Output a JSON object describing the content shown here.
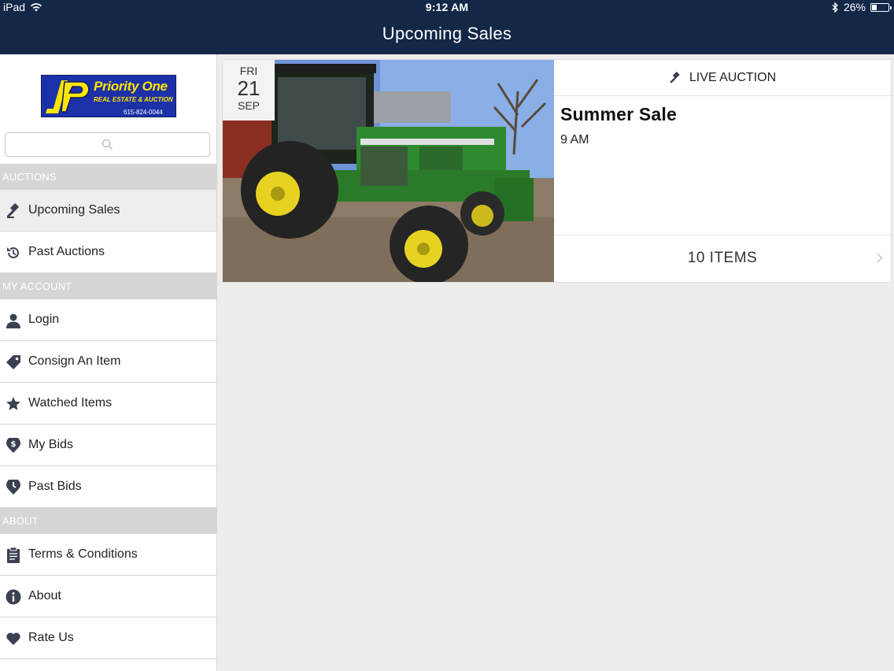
{
  "status": {
    "carrier": "iPad",
    "time": "9:12 AM",
    "battery": "26%",
    "battery_level": 0.26
  },
  "nav": {
    "title": "Upcoming Sales"
  },
  "logo": {
    "brand": "Priority One",
    "sub": "REAL ESTATE & AUCTION",
    "phone": "615-824-0044"
  },
  "sidebar": {
    "sections": [
      {
        "title": "AUCTIONS"
      },
      {
        "title": "MY ACCOUNT"
      },
      {
        "title": "ABOUT"
      }
    ],
    "items": [
      {
        "label": "Upcoming Sales",
        "icon": "gavel-icon"
      },
      {
        "label": "Past Auctions",
        "icon": "history-icon"
      },
      {
        "label": "Login",
        "icon": "user-icon"
      },
      {
        "label": "Consign An Item",
        "icon": "tag-icon"
      },
      {
        "label": "Watched Items",
        "icon": "star-icon"
      },
      {
        "label": "My Bids",
        "icon": "dollar-icon"
      },
      {
        "label": "Past Bids",
        "icon": "clock-badge-icon"
      },
      {
        "label": "Terms & Conditions",
        "icon": "clipboard-icon"
      },
      {
        "label": "About",
        "icon": "info-icon"
      },
      {
        "label": "Rate Us",
        "icon": "heart-icon"
      }
    ]
  },
  "sale": {
    "dow": "FRI",
    "day": "21",
    "month": "SEP",
    "type_label": "LIVE AUCTION",
    "title": "Summer Sale",
    "time": "9 AM",
    "items_label": "10 ITEMS"
  },
  "colors": {
    "nav_bg": "#132747",
    "section_bg": "#d7d6d6",
    "icon": "#3b4150"
  }
}
